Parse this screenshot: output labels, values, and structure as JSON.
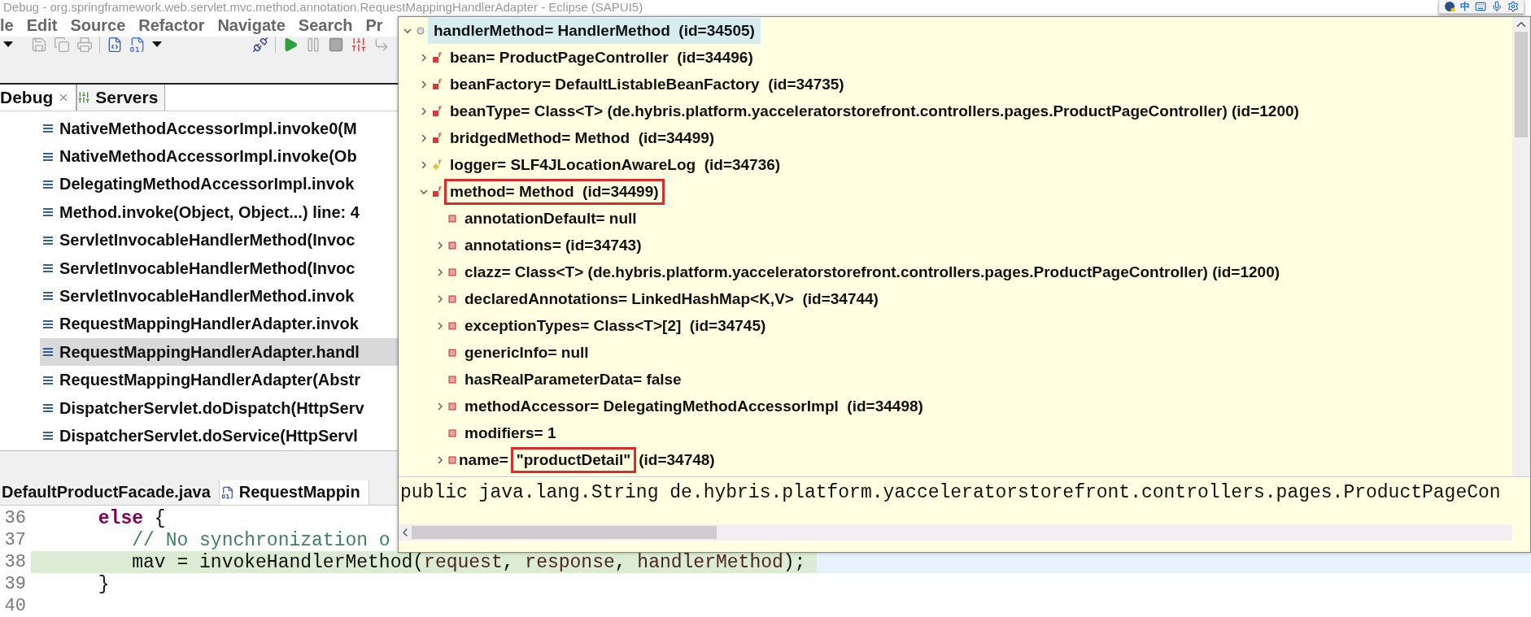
{
  "window": {
    "title": "Debug - org.springframework.web.servlet.mvc.method.annotation.RequestMappingHandlerAdapter - Eclipse (SAPUI5)"
  },
  "menu": [
    "le",
    "Edit",
    "Source",
    "Refactor",
    "Navigate",
    "Search",
    "Pr"
  ],
  "debug_tabs": [
    {
      "label": "Debug",
      "selected": true
    },
    {
      "label": "Servers",
      "selected": false
    }
  ],
  "stack_frames": [
    {
      "text": "NativeMethodAccessorImpl.invoke0(M",
      "selected": false
    },
    {
      "text": "NativeMethodAccessorImpl.invoke(Ob",
      "selected": false
    },
    {
      "text": "DelegatingMethodAccessorImpl.invok",
      "selected": false
    },
    {
      "text": "Method.invoke(Object, Object...) line: 4",
      "selected": false
    },
    {
      "text": "ServletInvocableHandlerMethod(Invoc",
      "selected": false
    },
    {
      "text": "ServletInvocableHandlerMethod(Invoc",
      "selected": false
    },
    {
      "text": "ServletInvocableHandlerMethod.invok",
      "selected": false
    },
    {
      "text": "RequestMappingHandlerAdapter.invok",
      "selected": false
    },
    {
      "text": "RequestMappingHandlerAdapter.handl",
      "selected": true
    },
    {
      "text": "RequestMappingHandlerAdapter(Abstr",
      "selected": false
    },
    {
      "text": "DispatcherServlet.doDispatch(HttpServ",
      "selected": false
    },
    {
      "text": "DispatcherServlet.doService(HttpServl",
      "selected": false
    }
  ],
  "editor_tabs": [
    {
      "label": "DefaultProductFacade.java",
      "selected": false
    },
    {
      "label": "RequestMappin",
      "selected": true
    }
  ],
  "code_lines": [
    {
      "number": "36",
      "current": false,
      "tokens": [
        {
          "kind": "keyword",
          "text": "      else"
        },
        {
          "kind": "plain",
          "text": " {"
        }
      ]
    },
    {
      "number": "37",
      "current": false,
      "tokens": [
        {
          "kind": "comment",
          "text": "         // No synchronization o"
        }
      ]
    },
    {
      "number": "38",
      "current": true,
      "tokens": [
        {
          "kind": "plain",
          "text": "         mav = invokeHandlerMethod("
        },
        {
          "kind": "param",
          "text": "request"
        },
        {
          "kind": "plain",
          "text": ", "
        },
        {
          "kind": "param",
          "text": "response"
        },
        {
          "kind": "plain",
          "text": ", "
        },
        {
          "kind": "param",
          "text": "handlerMethod"
        },
        {
          "kind": "plain",
          "text": ");"
        }
      ]
    },
    {
      "number": "39",
      "current": false,
      "tokens": [
        {
          "kind": "plain",
          "text": "      }"
        }
      ]
    },
    {
      "number": "40",
      "current": false
    }
  ],
  "inspector": {
    "tree": [
      {
        "kind": "local",
        "text": "handlerMethod= HandlerMethod  (id=34505)",
        "expanded": true,
        "selected": true,
        "boxed": false,
        "children": [
          {
            "kind": "final",
            "text": "bean= ProductPageController  (id=34496)",
            "expanded": false,
            "selected": false,
            "boxed": false
          },
          {
            "kind": "final",
            "text": "beanFactory= DefaultListableBeanFactory  (id=34735)",
            "expanded": false,
            "selected": false,
            "boxed": false
          },
          {
            "kind": "final",
            "text": "beanType= Class<T> (de.hybris.platform.yacceleratorstorefront.controllers.pages.ProductPageController) (id=1200)",
            "expanded": false,
            "selected": false,
            "boxed": false
          },
          {
            "kind": "final",
            "text": "bridgedMethod= Method  (id=34499)",
            "expanded": false,
            "selected": false,
            "boxed": false
          },
          {
            "kind": "static",
            "text": "logger= SLF4JLocationAwareLog  (id=34736)",
            "expanded": false,
            "selected": false,
            "boxed": false
          },
          {
            "kind": "final",
            "text": "method= Method  (id=34499)",
            "expanded": true,
            "selected": false,
            "boxed": true,
            "children": [
              {
                "kind": "private",
                "text": "annotationDefault= null",
                "selected": false,
                "boxed": false
              },
              {
                "kind": "private",
                "text": "annotations= (id=34743)",
                "expanded": false,
                "selected": false,
                "boxed": false
              },
              {
                "kind": "private",
                "text": "clazz= Class<T> (de.hybris.platform.yacceleratorstorefront.controllers.pages.ProductPageController) (id=1200)",
                "expanded": false,
                "selected": false,
                "boxed": false
              },
              {
                "kind": "private",
                "text": "declaredAnnotations= LinkedHashMap<K,V>  (id=34744)",
                "expanded": false,
                "selected": false,
                "boxed": false
              },
              {
                "kind": "private",
                "text": "exceptionTypes= Class<T>[2]  (id=34745)",
                "expanded": false,
                "selected": false,
                "boxed": false
              },
              {
                "kind": "private",
                "text": "genericInfo= null",
                "selected": false,
                "boxed": false
              },
              {
                "kind": "private",
                "text": "hasRealParameterData= false",
                "selected": false,
                "boxed": false
              },
              {
                "kind": "private",
                "text": "methodAccessor= DelegatingMethodAccessorImpl  (id=34498)",
                "expanded": false,
                "selected": false,
                "boxed": false
              },
              {
                "kind": "private",
                "text": "modifiers= 1",
                "selected": false,
                "boxed": false
              },
              {
                "kind": "private",
                "text": "name=",
                "value": "\"productDetail\"",
                "after": "(id=34748)",
                "expanded": false,
                "selected": false,
                "boxed": true
              }
            ]
          }
        ]
      }
    ],
    "detail": "public java.lang.String de.hybris.platform.yacceleratorstorefront.controllers.pages.ProductPageCon"
  },
  "ime_toolbar": {
    "label": "中"
  }
}
